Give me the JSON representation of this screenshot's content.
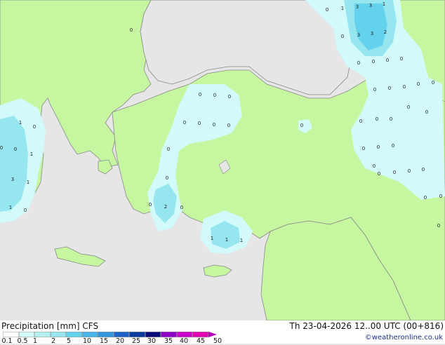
{
  "header": {
    "title": "Precipitation [mm]  CFS",
    "datetime": "Th 23-04-2026 12..00 UTC (00+816)",
    "credit": "©weatheronline.co.uk"
  },
  "legend": {
    "ticks": [
      "0.1",
      "0.5",
      "1",
      "2",
      "5",
      "10",
      "15",
      "20",
      "25",
      "30",
      "35",
      "40",
      "45",
      "50"
    ],
    "colors": [
      "#ffffff",
      "#d2fafa",
      "#b4f0f0",
      "#96e6f0",
      "#64d2ec",
      "#46b4e6",
      "#3296dc",
      "#1e64c8",
      "#0a3ca0",
      "#0a0a78",
      "#8c00c8",
      "#c800c8",
      "#e600b4",
      "#b000b0"
    ]
  },
  "map_colors": {
    "sea": "#e6e6e6",
    "land": "#c6f7a0",
    "precip_light": "#d2fafa",
    "precip_mid": "#96e6f0",
    "precip_high": "#64d2ec",
    "coast": "#888888"
  },
  "values": [
    "0",
    "1",
    "3",
    "3",
    "1",
    "0",
    "3",
    "3",
    "2",
    "0",
    "0",
    "0",
    "0",
    "0",
    "0",
    "0",
    "0",
    "0",
    "0",
    "0",
    "0",
    "0",
    "0",
    "0",
    "0",
    "0",
    "0",
    "0",
    "0",
    "0",
    "0",
    "0",
    "0",
    "0",
    "0",
    "0",
    "0",
    "0",
    "0",
    "0",
    "0",
    "0",
    "0",
    "1",
    "0",
    "1",
    "3",
    "1",
    "1",
    "0",
    "0",
    "0",
    "0",
    "0",
    "0",
    "2",
    "0",
    "1",
    "1",
    "1"
  ]
}
